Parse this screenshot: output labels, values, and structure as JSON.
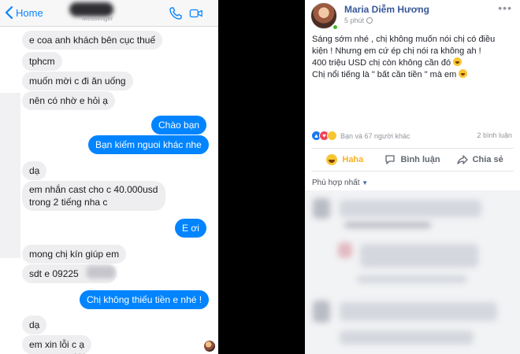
{
  "messenger": {
    "header": {
      "back_label": "Home",
      "subtitle": "Messenger",
      "call_icon": "phone-icon",
      "video_icon": "video-camera-icon"
    },
    "messages": [
      {
        "dir": "in",
        "text": "e coa anh khách bên cục thuế"
      },
      {
        "dir": "in",
        "text": "tphcm"
      },
      {
        "dir": "in",
        "text": "muốn mời c đi ăn uống"
      },
      {
        "dir": "in",
        "text": "nên có nhờ e hỏi ạ"
      },
      {
        "dir": "out",
        "text": "Chào bạn"
      },
      {
        "dir": "out",
        "text": "Bạn kiếm nguoi khác nhe"
      },
      {
        "dir": "in",
        "text": "dạ"
      },
      {
        "dir": "in",
        "text": "em nhắn cast cho c 40.000usd"
      },
      {
        "dir": "in",
        "text": "trong 2 tiếng nha c"
      },
      {
        "dir": "out",
        "text": "E ơi"
      },
      {
        "dir": "in",
        "text": "mong chị kín giúp em"
      },
      {
        "dir": "in",
        "text": "sdt e 09225"
      },
      {
        "dir": "out",
        "text": "Chị không thiếu tiền e nhé !"
      },
      {
        "dir": "in",
        "text": "dạ"
      },
      {
        "dir": "in",
        "text": "em xin lỗi c ạ"
      }
    ],
    "typing_indicator": "• • •",
    "colors": {
      "accent": "#0084ff",
      "incoming": "#eeeef0"
    }
  },
  "post": {
    "author": "Maria Diễm Hương",
    "time": "5 phút",
    "more_icon": "more-options-icon",
    "lines": [
      "Sáng sớm nhé , chị không muốn nói chị có điều",
      "kiện ! Nhưng em cứ ép chị nói ra không ah !",
      "400 triệu USD chị còn không cần đó",
      "Chị nổi tiếng là \" bất cần tiền \" mà em"
    ],
    "reactions_text": "Bạn và 67 người khác",
    "comments_count": "2 bình luận",
    "actions": {
      "haha": "Haha",
      "comment": "Bình luận",
      "share": "Chia sẻ"
    },
    "sort_label": "Phù hợp nhất",
    "colors": {
      "name": "#385898",
      "link": "#4267b2",
      "haha": "#f7b125"
    }
  }
}
